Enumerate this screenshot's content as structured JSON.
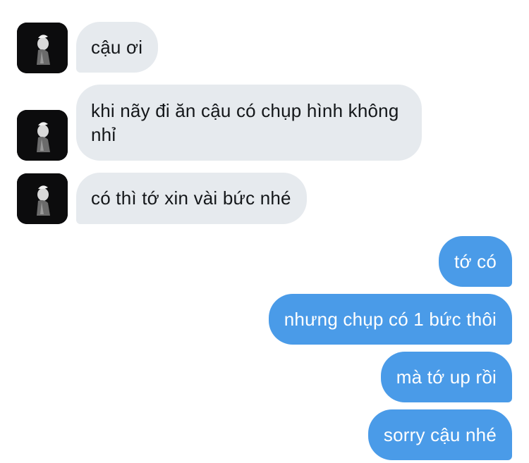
{
  "conversation": {
    "messages": [
      {
        "text": "cậu ơi"
      },
      {
        "text": "khi nãy đi ăn cậu có chụp hình không nhỉ"
      },
      {
        "text": "có thì tớ xin vài bức nhé"
      },
      {
        "text": "tớ có"
      },
      {
        "text": "nhưng chụp có 1 bức thôi"
      },
      {
        "text": "mà tớ up rồi"
      },
      {
        "text": "sorry cậu nhé"
      }
    ]
  },
  "colors": {
    "incoming_bubble": "#e6eaee",
    "outgoing_bubble": "#4a9be8",
    "incoming_text": "#14171a",
    "outgoing_text": "#ffffff"
  },
  "icons": {
    "contact_avatar": "avatar-photo"
  }
}
